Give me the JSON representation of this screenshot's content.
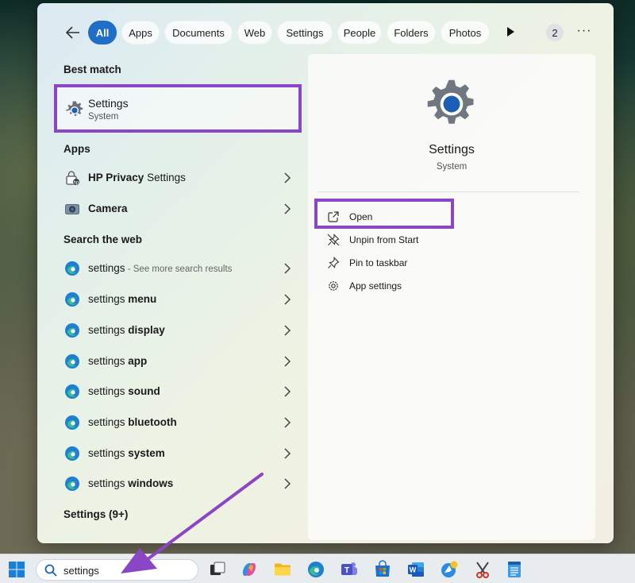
{
  "filters": {
    "tabs": [
      "All",
      "Apps",
      "Documents",
      "Web",
      "Settings",
      "People",
      "Folders",
      "Photos"
    ],
    "active": "All",
    "count_badge": "2",
    "more": "···"
  },
  "best_match": {
    "heading": "Best match",
    "title": "Settings",
    "subtitle": "System"
  },
  "apps": {
    "heading": "Apps",
    "items": [
      {
        "bold": "HP Privacy",
        "rest": " Settings"
      },
      {
        "bold": "Camera",
        "rest": ""
      }
    ]
  },
  "web": {
    "heading": "Search the web",
    "first": {
      "label": "settings",
      "extra": " - See more search results"
    },
    "items": [
      {
        "light": "settings ",
        "bold": "menu"
      },
      {
        "light": "settings ",
        "bold": "display"
      },
      {
        "light": "settings ",
        "bold": "app"
      },
      {
        "light": "settings ",
        "bold": "sound"
      },
      {
        "light": "settings ",
        "bold": "bluetooth"
      },
      {
        "light": "settings ",
        "bold": "system"
      },
      {
        "light": "settings ",
        "bold": "windows"
      }
    ]
  },
  "more_results": "Settings (9+)",
  "detail": {
    "title": "Settings",
    "subtitle": "System",
    "actions": [
      "Open",
      "Unpin from Start",
      "Pin to taskbar",
      "App settings"
    ]
  },
  "taskbar": {
    "search_value": "settings",
    "apps": [
      "task-view-icon",
      "copilot-icon",
      "file-explorer-icon",
      "edge-icon",
      "teams-icon",
      "store-icon",
      "word-icon",
      "maps-icon",
      "snipping-tool-icon",
      "notepad-icon"
    ]
  },
  "colors": {
    "accent": "#1f6fc9",
    "highlight_box": "#8b46c6"
  }
}
